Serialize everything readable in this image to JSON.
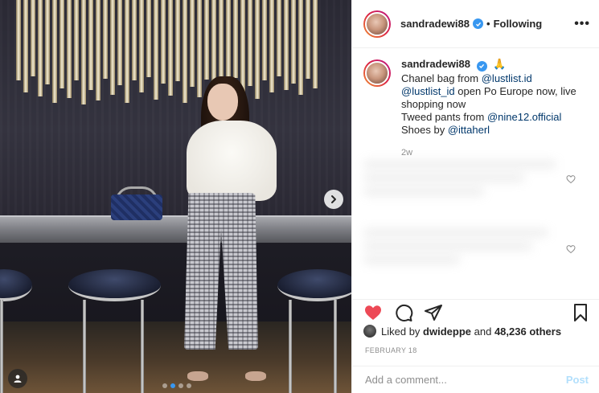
{
  "post": {
    "username": "sandradewi88",
    "follow_separator": "•",
    "follow_status": "Following",
    "more_label": "•••"
  },
  "caption": {
    "username": "sandradewi88",
    "emoji": "🙏",
    "line1_prefix": "Chanel bag from ",
    "mention1": "@lustlist.id",
    "mention2": "@lustlist_id",
    "line2_suffix": " open Po Europe now, live shopping now",
    "line3_prefix": "Tweed pants from ",
    "mention3": "@nine12.official",
    "line4_prefix": "Shoes by ",
    "mention4": "@ittaherl",
    "age": "2w"
  },
  "likes": {
    "prefix": "Liked by ",
    "user": "dwideppe",
    "middle": " and ",
    "count": "48,236 others"
  },
  "date": "FEBRUARY 18",
  "comment": {
    "placeholder": "Add a comment...",
    "post_label": "Post"
  },
  "carousel": {
    "total": 4,
    "active_index": 1
  },
  "colors": {
    "heart": "#ed4956",
    "verified": "#3897f0",
    "mention": "#00376b",
    "muted": "#8e8e8e",
    "post_disabled": "#b2dffc"
  }
}
